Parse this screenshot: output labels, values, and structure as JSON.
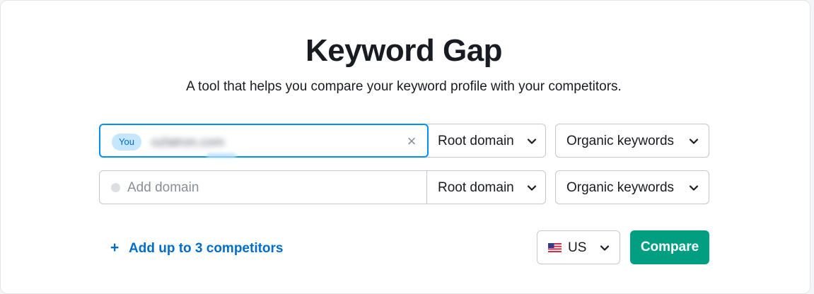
{
  "header": {
    "title": "Keyword Gap",
    "subtitle": "A tool that helps you compare your keyword profile with your competitors."
  },
  "rows": [
    {
      "tag": "You",
      "domain_value": "ozlatron.com",
      "scope": "Root domain",
      "keyword_type": "Organic keywords"
    },
    {
      "placeholder": "Add domain",
      "scope": "Root domain",
      "keyword_type": "Organic keywords"
    }
  ],
  "actions": {
    "add_competitors_label": "Add up to 3 competitors",
    "database": "US",
    "compare_label": "Compare"
  },
  "icons": {
    "clear": "close-icon",
    "chevron": "chevron-down-icon",
    "plus": "plus-icon",
    "flag": "us-flag-icon"
  },
  "colors": {
    "accent_blue": "#006dca",
    "focus_border": "#008ff8",
    "compare_green": "#009f81",
    "you_tag_bg": "#c4e6ff"
  }
}
